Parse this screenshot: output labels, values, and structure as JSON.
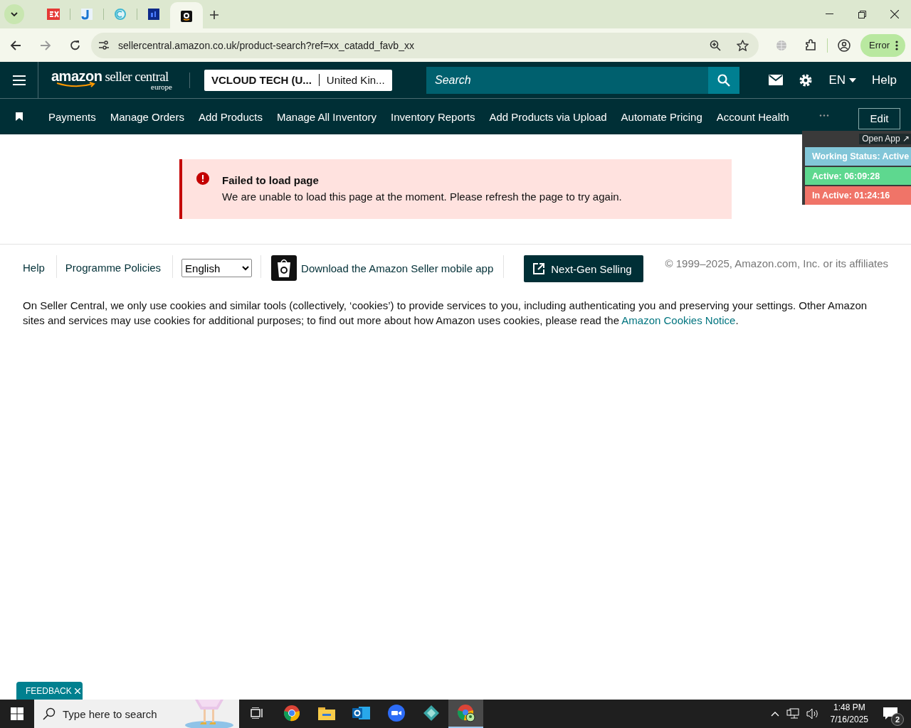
{
  "browser": {
    "tabs": [
      {
        "kind": "ex",
        "selected": false
      },
      {
        "kind": "cloud",
        "selected": false
      },
      {
        "kind": "ring",
        "selected": false
      },
      {
        "kind": "df",
        "selected": false
      },
      {
        "kind": "amazon",
        "selected": true
      }
    ],
    "url": "sellercentral.amazon.co.uk/product-search?ref=xx_catadd_favb_xx",
    "profile_status": "Error"
  },
  "header": {
    "logo": {
      "brand": "amazon",
      "product": "seller central",
      "region": "europe"
    },
    "account": "VCLOUD TECH (U...",
    "marketplace": "United Kin...",
    "search": {
      "placeholder": "Search"
    },
    "language": "EN",
    "help": "Help"
  },
  "nav": {
    "items": [
      "Payments",
      "Manage Orders",
      "Add Products",
      "Manage All Inventory",
      "Inventory Reports",
      "Add Products via Upload",
      "Automate Pricing",
      "Account Health"
    ],
    "edit": "Edit"
  },
  "tracker": {
    "open_app": "Open App ↗",
    "rows": [
      {
        "text": "Working Status: Active",
        "color": "#82c6d8"
      },
      {
        "text": "Active: 06:09:28",
        "color": "#5ed88f"
      },
      {
        "text": "In Active: 01:24:16",
        "color": "#f07468"
      }
    ]
  },
  "alert": {
    "title": "Failed to load page",
    "message": "We are unable to load this page at the moment. Please refresh the page to try again."
  },
  "footer": {
    "links": [
      "Help",
      "Programme Policies"
    ],
    "language": "English",
    "app_link": "Download the Amazon Seller mobile app",
    "next_gen": "Next-Gen Selling",
    "copyright": "© 1999–2025, Amazon.com, Inc. or its affiliates",
    "cookies": "On Seller Central, we only use cookies and similar tools (collectively, ‘cookies’) to provide services to you, including authenticating you and preserving your settings. Other Amazon sites and services may use cookies for additional purposes; to find out more about how Amazon uses cookies, please read the ",
    "cookies_link": "Amazon Cookies Notice",
    "cookies_end": "."
  },
  "feedback": "FEEDBACK",
  "taskbar": {
    "search_placeholder": "Type here to search",
    "apps": [
      {
        "kind": "chrome",
        "selected": false
      },
      {
        "kind": "folder",
        "selected": false
      },
      {
        "kind": "outlook",
        "selected": false
      },
      {
        "kind": "zoom",
        "selected": false
      },
      {
        "kind": "gem",
        "selected": false
      },
      {
        "kind": "chrome-profile",
        "selected": true
      }
    ],
    "time": "1:48 PM",
    "date": "7/16/2025",
    "notifications": "2"
  }
}
